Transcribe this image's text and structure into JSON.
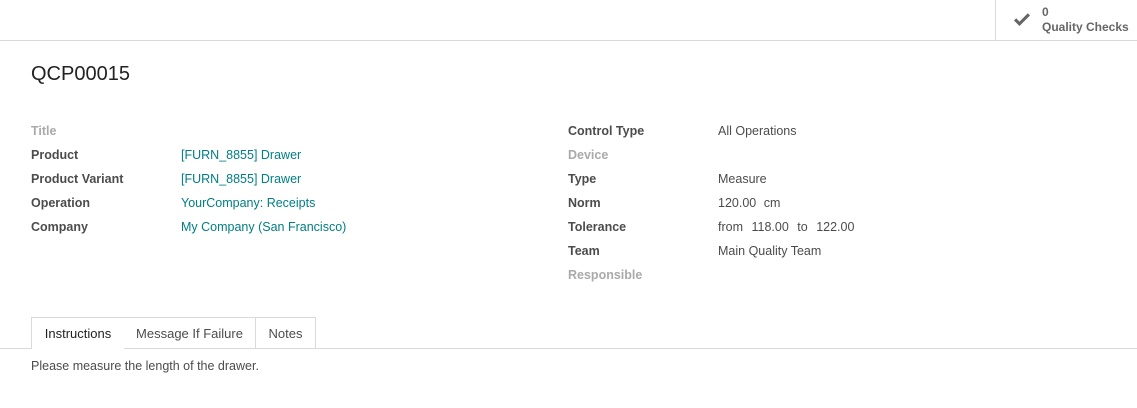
{
  "stat_button": {
    "value": "0",
    "label": "Quality Checks",
    "icon": "check-icon"
  },
  "record": {
    "name": "QCP00015"
  },
  "left_fields": [
    {
      "label": "Title",
      "value": "",
      "muted": true
    },
    {
      "label": "Product",
      "value": "[FURN_8855] Drawer",
      "link": true
    },
    {
      "label": "Product Variant",
      "value": "[FURN_8855] Drawer",
      "link": true
    },
    {
      "label": "Operation",
      "value": "YourCompany: Receipts",
      "link": true
    },
    {
      "label": "Company",
      "value": "My Company (San Francisco)",
      "link": true
    }
  ],
  "right_fields": {
    "control_type": {
      "label": "Control Type",
      "value": "All Operations"
    },
    "device": {
      "label": "Device",
      "value": ""
    },
    "type": {
      "label": "Type",
      "value": "Measure"
    },
    "norm": {
      "label": "Norm",
      "value": "120.00",
      "unit": "cm"
    },
    "tolerance": {
      "label": "Tolerance",
      "from_label": "from",
      "from": "118.00",
      "to_label": "to",
      "to": "122.00"
    },
    "team": {
      "label": "Team",
      "value": "Main Quality Team"
    },
    "responsible": {
      "label": "Responsible",
      "value": ""
    }
  },
  "tabs": [
    {
      "label": "Instructions",
      "active": true
    },
    {
      "label": "Message If Failure",
      "active": false
    },
    {
      "label": "Notes",
      "active": false
    }
  ],
  "tab_content": "Please measure the length of the drawer.",
  "colors": {
    "link": "#017e84",
    "muted_label": "#aaaaaa",
    "border": "#d9d9d9"
  }
}
